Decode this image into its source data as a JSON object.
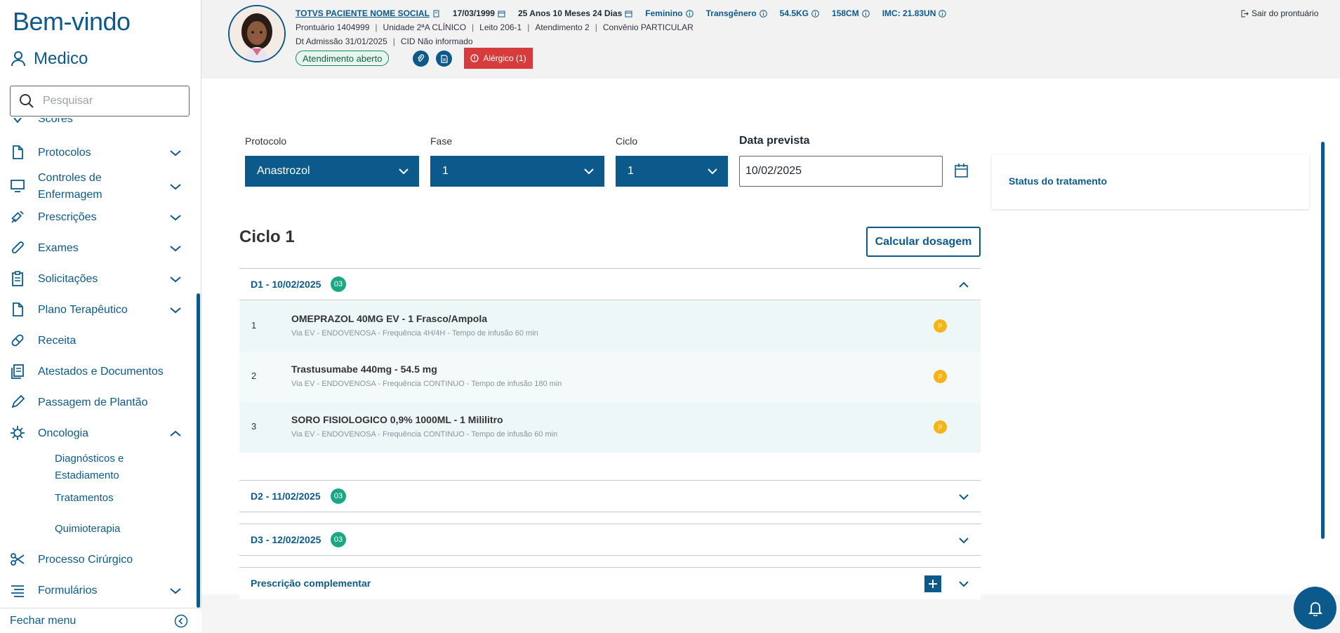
{
  "sidebar": {
    "welcome": "Bem-vindo",
    "user": "Medico",
    "search_placeholder": "Pesquisar",
    "items": [
      {
        "label": "Scores"
      },
      {
        "label": "Protocolos"
      },
      {
        "label": "Controles de Enfermagem"
      },
      {
        "label": "Prescrições"
      },
      {
        "label": "Exames"
      },
      {
        "label": "Solicitações"
      },
      {
        "label": "Plano Terapêutico"
      },
      {
        "label": "Receita"
      },
      {
        "label": "Atestados e Documentos"
      },
      {
        "label": "Passagem de Plantão"
      },
      {
        "label": "Oncologia"
      },
      {
        "label": "Processo Cirúrgico"
      },
      {
        "label": "Formulários"
      }
    ],
    "oncologia_sub": [
      "Diagnósticos e Estadiamento",
      "Tratamentos",
      "Quimioterapia"
    ],
    "footer": "Fechar menu"
  },
  "patient": {
    "name": "TOTVS PACIENTE NOME SOCIAL",
    "birth": "17/03/1999",
    "age": "25 Anos 10 Meses 24 Dias",
    "gender": "Feminino",
    "identity": "Transgênero",
    "weight": "54.5KG",
    "height": "158CM",
    "imc": "IMC: 21.83UN",
    "line2": [
      "Prontuário 1404999",
      "Unidade 2ªA CLÍNICO",
      "Leito 206-1",
      "Atendimento 2",
      "Convênio PARTICULAR"
    ],
    "line3": [
      "Dt Admissão 31/01/2025",
      "CID Não informado"
    ],
    "status": "Atendimento aberto",
    "allergy": "Alérgico (1)",
    "exit": "Sair do prontuário"
  },
  "form": {
    "protocolo_label": "Protocolo",
    "protocolo_value": "Anastrozol",
    "fase_label": "Fase",
    "fase_value": "1",
    "ciclo_label": "Ciclo",
    "ciclo_value": "1",
    "data_label": "Data prevista",
    "data_value": "10/02/2025"
  },
  "status_card": {
    "title": "Status do tratamento"
  },
  "cycle": {
    "title": "Ciclo 1",
    "calc_button": "Calcular dosagem",
    "days": [
      {
        "label": "D1 - 10/02/2025",
        "count": "03"
      },
      {
        "label": "D2 - 11/02/2025",
        "count": "03"
      },
      {
        "label": "D3 - 12/02/2025",
        "count": "03"
      }
    ],
    "drugs": [
      {
        "index": "1",
        "name": "OMEPRAZOL 40MG EV - 1 Frasco/Ampola",
        "detail": "Via EV - ENDOVENOSA - Frequência 4H/4H - Tempo de infusão 60 min",
        "badge": "P"
      },
      {
        "index": "2",
        "name": "Trastusumabe 440mg - 54.5 mg",
        "detail": "Via EV - ENDOVENOSA - Frequência CONTINUO - Tempo de infusão 180 min",
        "badge": "P"
      },
      {
        "index": "3",
        "name": "SORO FISIOLOGICO 0,9% 1000ML - 1 Mililitro",
        "detail": "Via EV - ENDOVENOSA - Frequência CONTINUO - Tempo de infusão 60 min",
        "badge": "P"
      }
    ],
    "complementar": "Prescrição complementar"
  },
  "colors": {
    "primary": "#0c5a8c",
    "allergy": "#d73b3b",
    "badge_green": "#18a884",
    "badge_orange": "#f5b41a"
  }
}
